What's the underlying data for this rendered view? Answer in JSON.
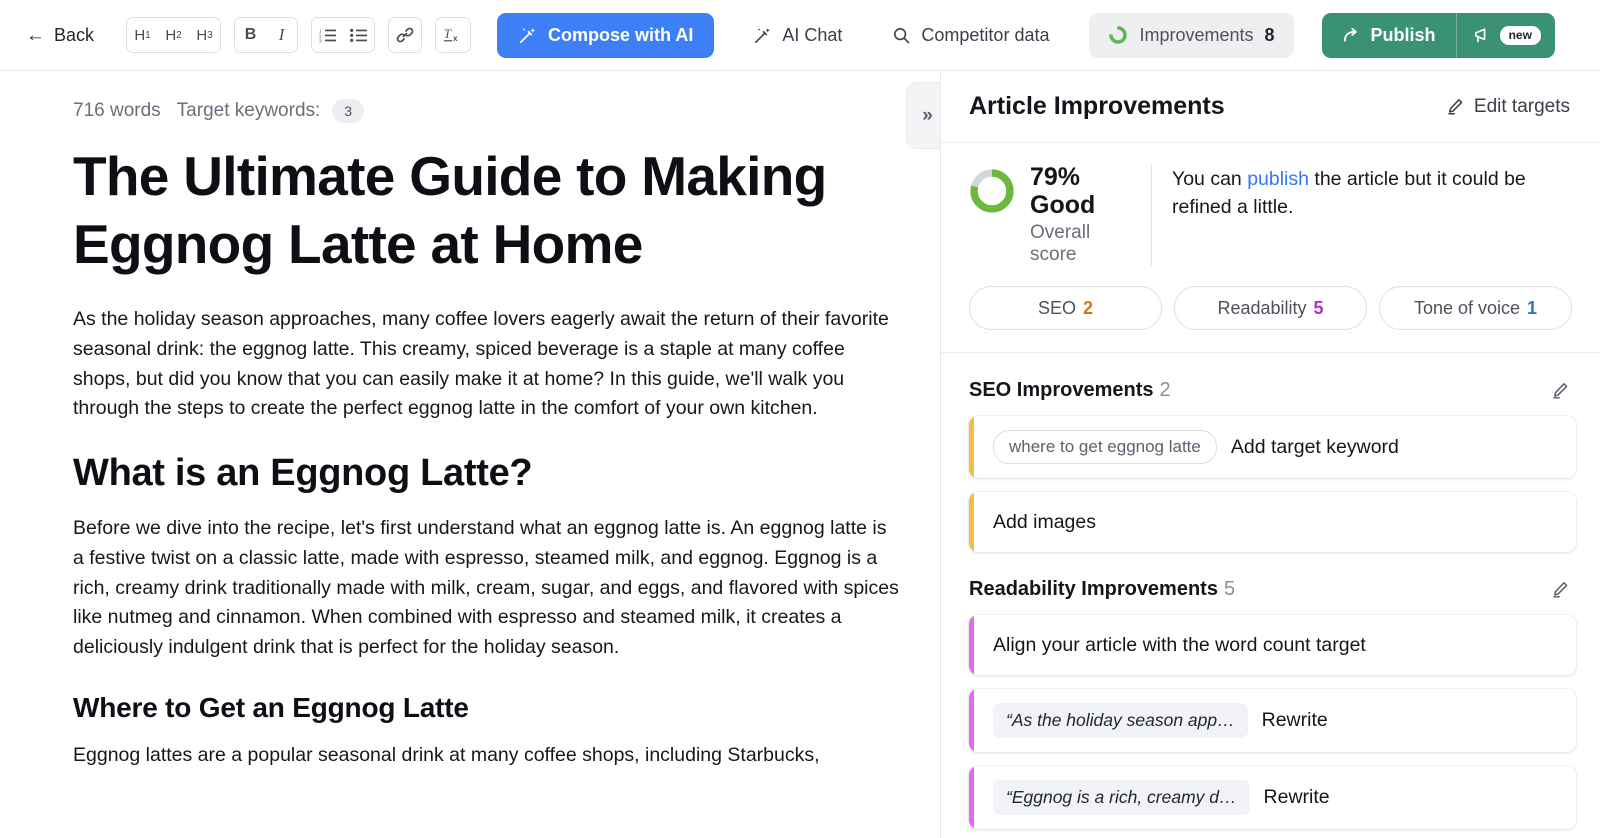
{
  "toolbar": {
    "back_label": "Back",
    "heading_buttons": [
      {
        "name": "h1-button",
        "label": "H",
        "sub": "1"
      },
      {
        "name": "h2-button",
        "label": "H",
        "sub": "2"
      },
      {
        "name": "h3-button",
        "label": "H",
        "sub": "3"
      }
    ],
    "bold_label": "B",
    "italic_label": "I",
    "compose_label": "Compose with AI",
    "ai_chat_label": "AI Chat",
    "competitor_label": "Competitor data",
    "improvements_label": "Improvements",
    "improvements_count": "8",
    "publish_label": "Publish",
    "new_badge": "new",
    "colors": {
      "compose_blue": "#3d7ff5",
      "publish_green": "#3a9175",
      "improvements_ring": "#57b947"
    }
  },
  "editor": {
    "word_count": "716 words",
    "target_keywords_label": "Target keywords:",
    "target_keywords_count": "3",
    "title": "The Ultimate Guide to Making Eggnog Latte at Home",
    "paragraph_1": "As the holiday season approaches, many coffee lovers eagerly await the return of their favorite seasonal drink: the eggnog latte. This creamy, spiced beverage is a staple at many coffee shops, but did you know that you can easily make it at home? In this guide, we'll walk you through the steps to create the perfect eggnog latte in the comfort of your own kitchen.",
    "heading_2": "What is an Eggnog Latte?",
    "paragraph_2": "Before we dive into the recipe, let's first understand what an eggnog latte is. An eggnog latte is a festive twist on a classic latte, made with espresso, steamed milk, and eggnog. Eggnog is a rich, creamy drink traditionally made with milk, cream, sugar, and eggs, and flavored with spices like nutmeg and cinnamon. When combined with espresso and steamed milk, it creates a deliciously indulgent drink that is perfect for the holiday season.",
    "heading_3": "Where to Get an Eggnog Latte",
    "paragraph_3": "Eggnog lattes are a popular seasonal drink at many coffee shops, including Starbucks,"
  },
  "panel": {
    "title": "Article Improvements",
    "edit_targets_label": "Edit targets",
    "score": {
      "percent": "79% Good",
      "percent_value": 79,
      "sub_label": "Overall score",
      "message_before": "You can ",
      "message_link": "publish",
      "message_after": " the article but it could be refined a little.",
      "ring_color": "#6ab93c",
      "track_color": "#d4d6db"
    },
    "chips": [
      {
        "name": "chip-seo",
        "label": "SEO",
        "count": "2",
        "color": "#cc7a11"
      },
      {
        "name": "chip-readability",
        "label": "Readability",
        "count": "5",
        "color": "#b32fcb"
      },
      {
        "name": "chip-tone",
        "label": "Tone of voice",
        "count": "1",
        "color": "#2e6fe0"
      }
    ],
    "sections": [
      {
        "name": "seo-improvements",
        "title": "SEO Improvements",
        "count": "2",
        "accent": "#f3bd48",
        "items": [
          {
            "name": "improvement-add-target-keyword",
            "pill": "where to get eggnog latte",
            "pill_style": "keyword",
            "label": "Add target keyword"
          },
          {
            "name": "improvement-add-images",
            "pill": null,
            "pill_style": null,
            "label": "Add images"
          }
        ]
      },
      {
        "name": "readability-improvements",
        "title": "Readability Improvements",
        "count": "5",
        "accent": "#e06bf0",
        "items": [
          {
            "name": "improvement-word-count-target",
            "pill": null,
            "pill_style": null,
            "label": "Align your article with the word count target"
          },
          {
            "name": "improvement-rewrite-1",
            "pill": "“As the holiday season app…",
            "pill_style": "quote",
            "label": "Rewrite"
          },
          {
            "name": "improvement-rewrite-2",
            "pill": "“Eggnog is a rich, creamy d…",
            "pill_style": "quote",
            "label": "Rewrite"
          }
        ]
      }
    ]
  }
}
